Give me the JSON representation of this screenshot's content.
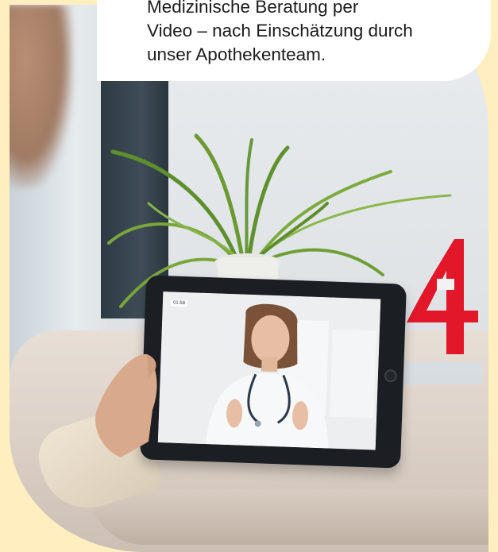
{
  "caption": {
    "lines": [
      "Medizinische Beratung per",
      "Video – nach Einschätzung durch",
      "unser Apothekenteam."
    ]
  },
  "tablet": {
    "badge": "01:58"
  },
  "colors": {
    "background": "#FFEFC0",
    "brand_red": "#E3172A",
    "caption_background": "#FFFFFF"
  },
  "icons": {
    "logo": "pharmacy-4-logo-icon"
  }
}
